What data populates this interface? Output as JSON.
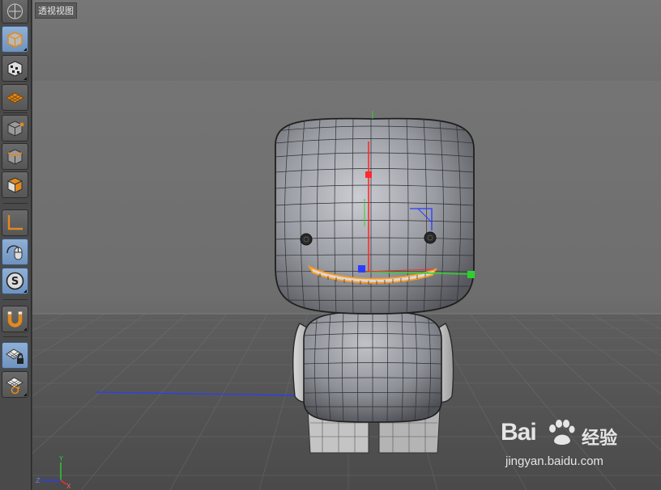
{
  "viewport": {
    "label": "透视视图",
    "axis_gizmo": {
      "y": "Y",
      "z": "Z",
      "x": "X"
    }
  },
  "toolbar": {
    "items": [
      {
        "name": "view-cube-icon"
      },
      {
        "name": "model-mode-icon",
        "active": true
      },
      {
        "name": "texture-mode-icon"
      },
      {
        "name": "workplane-icon"
      },
      {
        "name": "points-mode-icon"
      },
      {
        "name": "edges-mode-icon"
      },
      {
        "name": "polygons-mode-icon"
      },
      {
        "name": "axis-mode-icon"
      },
      {
        "name": "tweak-mode-icon",
        "active": true
      },
      {
        "name": "solo-icon",
        "active": true
      },
      {
        "name": "snap-magnet-icon"
      },
      {
        "name": "workplane-lock-icon",
        "active": true
      },
      {
        "name": "workplane-align-icon"
      }
    ]
  },
  "watermark": {
    "brand": "Bai",
    "cn": "经验",
    "url": "jingyan.baidu.com"
  },
  "colors": {
    "axis_x": "#ff2a2a",
    "axis_y": "#2dd12d",
    "axis_z": "#2a3cff",
    "selection": "#ff9a1a",
    "active_tool": "#7ea3cf"
  }
}
